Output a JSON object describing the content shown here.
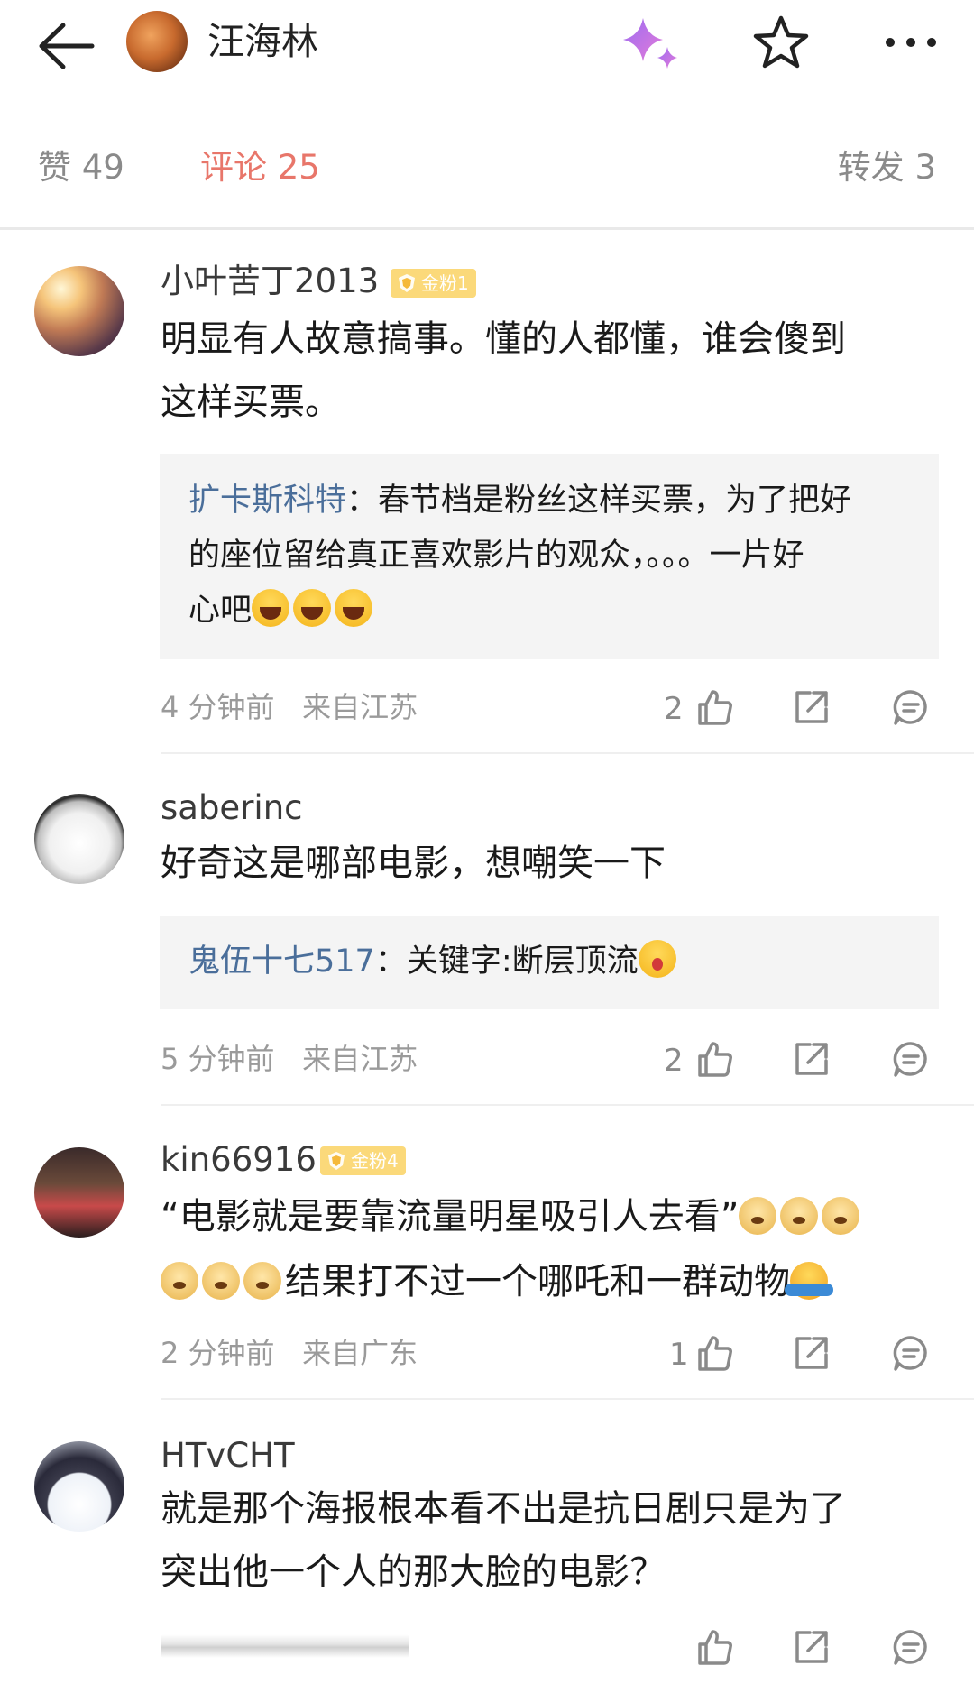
{
  "header": {
    "title": "汪海林",
    "back_icon": "arrow-left-icon",
    "sparkle_icon": "sparkle-icon",
    "star_icon": "star-icon",
    "more_icon": "more-dots-icon",
    "sparkle_colors": [
      "#a56cf0",
      "#e47ad8"
    ]
  },
  "tabs": {
    "likes": "赞 49",
    "comments": "评论 25",
    "reposts": "转发 3",
    "active_color": "#e8766a"
  },
  "comments": [
    {
      "username": "小叶苦丁2013",
      "badge": "金粉1",
      "text_line1": "明显有人故意搞事。懂的人都懂，谁会傻到",
      "text_line2": "这样买票。",
      "reply_author": "扩卡斯科特",
      "reply_line1": "：春节档是粉丝这样买票，为了把好",
      "reply_line2": "的座位留给真正喜欢影片的观众，。。。一片好",
      "reply_line3": "心吧",
      "time": "4 分钟前",
      "location": "来自江苏",
      "likes": "2"
    },
    {
      "username": "saberinc",
      "text_line1": "好奇这是哪部电影，想嘲笑一下",
      "reply_author": "鬼伍十七517",
      "reply_line1": "：关键字:断层顶流",
      "time": "5 分钟前",
      "location": "来自江苏",
      "likes": "2"
    },
    {
      "username": "kin66916",
      "badge": "金粉4",
      "text_line1": "“电影就是要靠流量明星吸引人去看”",
      "text_line2": "结果打不过一个哪吒和一群动物",
      "time": "2 分钟前",
      "location": "来自广东",
      "likes": "1"
    },
    {
      "username": "HTvCHT",
      "text_line1": "就是那个海报根本看不出是抗日剧只是为了",
      "text_line2": "突出他一个人的那大脸的电影？"
    }
  ]
}
